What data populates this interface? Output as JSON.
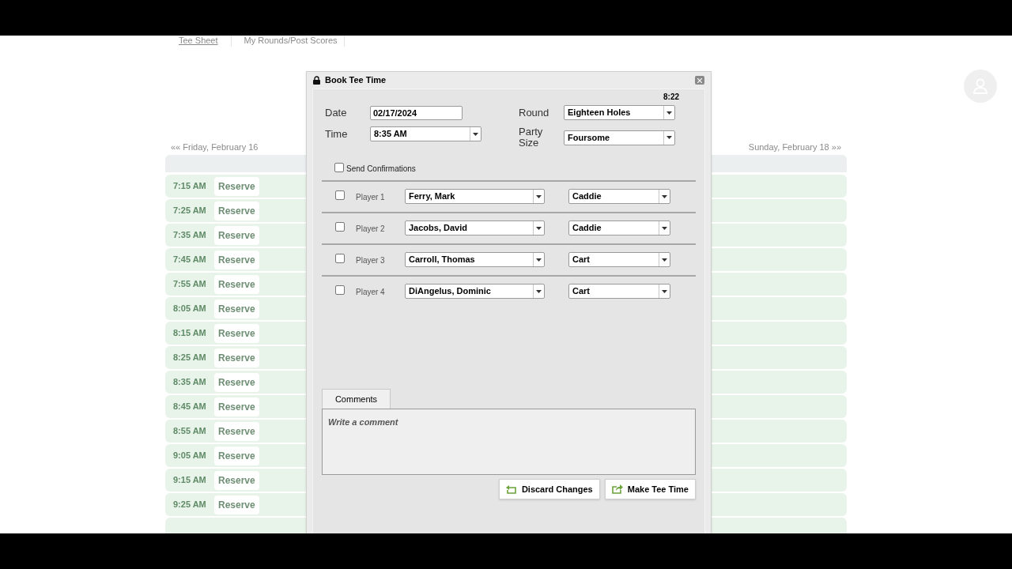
{
  "tabs": [
    {
      "label": "Tee Sheet",
      "selected": true
    },
    {
      "label": "My Rounds/Post Scores",
      "selected": false
    }
  ],
  "day_nav": {
    "previous": "«« Friday, February 16",
    "next": "Sunday, February 18 »»"
  },
  "tee_times": [
    {
      "time": "7:15 AM",
      "action": "Reserve"
    },
    {
      "time": "7:25 AM",
      "action": "Reserve"
    },
    {
      "time": "7:35 AM",
      "action": "Reserve"
    },
    {
      "time": "7:45 AM",
      "action": "Reserve"
    },
    {
      "time": "7:55 AM",
      "action": "Reserve"
    },
    {
      "time": "8:05 AM",
      "action": "Reserve"
    },
    {
      "time": "8:15 AM",
      "action": "Reserve"
    },
    {
      "time": "8:25 AM",
      "action": "Reserve"
    },
    {
      "time": "8:35 AM",
      "action": "Reserve"
    },
    {
      "time": "8:45 AM",
      "action": "Reserve"
    },
    {
      "time": "8:55 AM",
      "action": "Reserve"
    },
    {
      "time": "9:05 AM",
      "action": "Reserve"
    },
    {
      "time": "9:15 AM",
      "action": "Reserve"
    },
    {
      "time": "9:25 AM",
      "action": "Reserve"
    }
  ],
  "dialog": {
    "title": "Book Tee Time",
    "clock": "8:22",
    "date": {
      "label": "Date",
      "value": "02/17/2024"
    },
    "time": {
      "label": "Time",
      "value": "8:35 AM"
    },
    "round": {
      "label": "Round",
      "value": "Eighteen Holes"
    },
    "party_size": {
      "label": "Party Size",
      "value": "Foursome"
    },
    "send_confirmations": {
      "label": "Send Confirmations",
      "checked": false
    },
    "players": [
      {
        "label": "Player 1",
        "checked": false,
        "name": "Ferry, Mark",
        "transport": "Caddie"
      },
      {
        "label": "Player 2",
        "checked": false,
        "name": "Jacobs,  David",
        "transport": "Caddie"
      },
      {
        "label": "Player 3",
        "checked": false,
        "name": "Carroll,  Thomas",
        "transport": "Cart"
      },
      {
        "label": "Player 4",
        "checked": false,
        "name": "DiAngelus,  Dominic",
        "transport": "Cart"
      }
    ],
    "comments": {
      "tab": "Comments",
      "placeholder": "Write a comment"
    },
    "buttons": [
      {
        "label": "Discard Changes",
        "kind": "discard"
      },
      {
        "label": "Make Tee Time",
        "kind": "submit"
      }
    ]
  }
}
